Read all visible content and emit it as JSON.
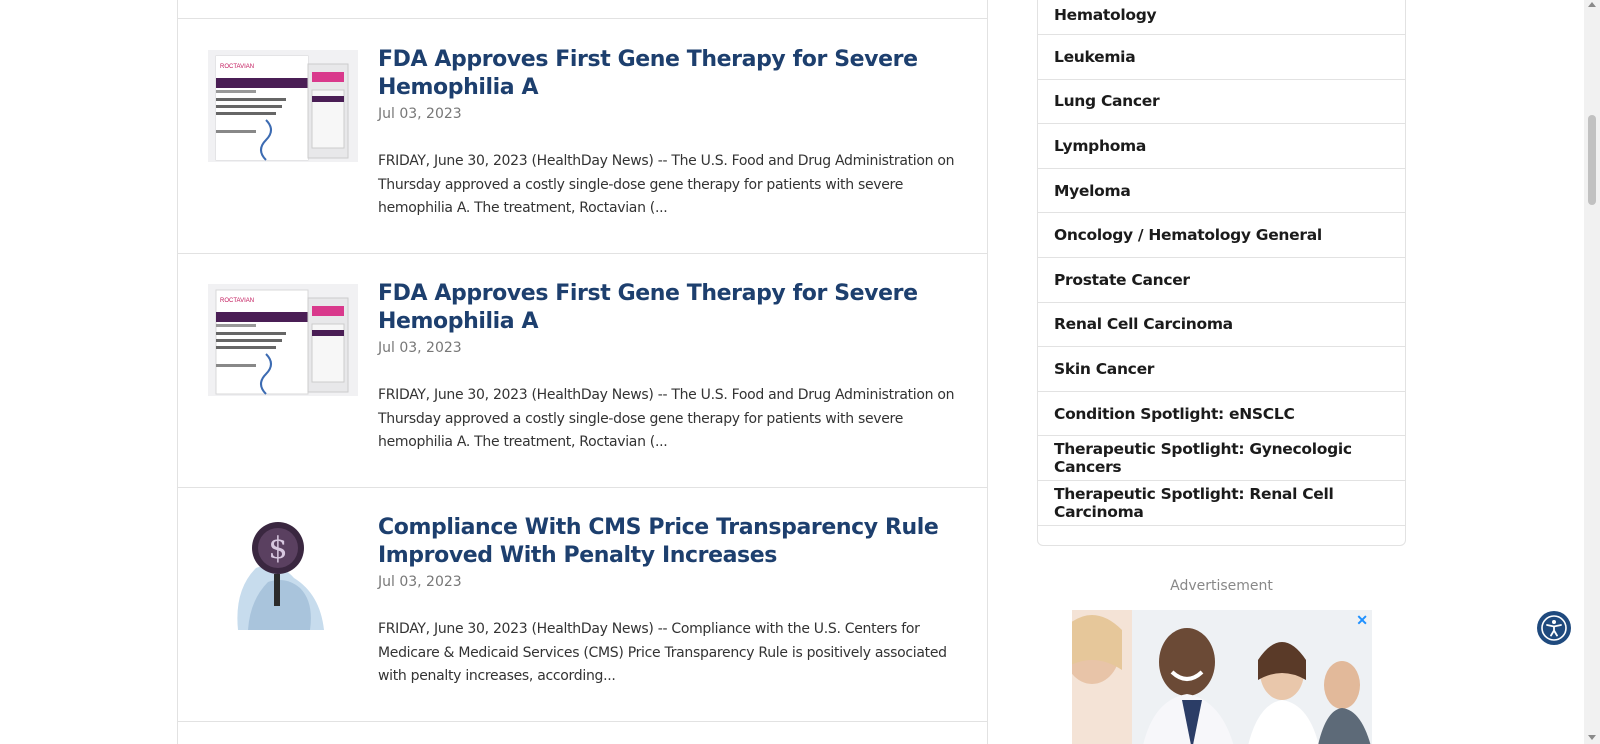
{
  "articles": [
    {
      "title": "FDA Approves First Gene Therapy for Severe Hemophilia A",
      "date": "Jul 03, 2023",
      "excerpt": "FRIDAY, June 30, 2023 (HealthDay News) -- The U.S. Food and Drug Administration on Thursday approved a costly single-dose gene therapy for patients with severe hemophilia A. The treatment, Roctavian (...",
      "thumb_brand": "ROCTAVIAN"
    },
    {
      "title": "FDA Approves First Gene Therapy for Severe Hemophilia A",
      "date": "Jul 03, 2023",
      "excerpt": "FRIDAY, June 30, 2023 (HealthDay News) -- The U.S. Food and Drug Administration on Thursday approved a costly single-dose gene therapy for patients with severe hemophilia A. The treatment, Roctavian (...",
      "thumb_brand": "ROCTAVIAN"
    },
    {
      "title": "Compliance With CMS Price Transparency Rule Improved With Penalty Increases",
      "date": "Jul 03, 2023",
      "excerpt": "FRIDAY, June 30, 2023 (HealthDay News) -- Compliance with the U.S. Centers for Medicare & Medicaid Services (CMS) Price Transparency Rule is positively associated with penalty increases, according...",
      "thumb_brand": ""
    }
  ],
  "sidebar": {
    "categories": [
      "Hematology",
      "Leukemia",
      "Lung Cancer",
      "Lymphoma",
      "Myeloma",
      "Oncology / Hematology General",
      "Prostate Cancer",
      "Renal Cell Carcinoma",
      "Skin Cancer",
      "Condition Spotlight: eNSCLC",
      "Therapeutic Spotlight: Gynecologic Cancers",
      "Therapeutic Spotlight: Renal Cell Carcinoma"
    ]
  },
  "advertisement": {
    "label": "Advertisement",
    "close": "✕"
  },
  "icons": {
    "accessibility": "accessibility-icon"
  },
  "colors": {
    "headline": "#1d3f6e",
    "accessibility_bg": "#1f4a7e"
  }
}
